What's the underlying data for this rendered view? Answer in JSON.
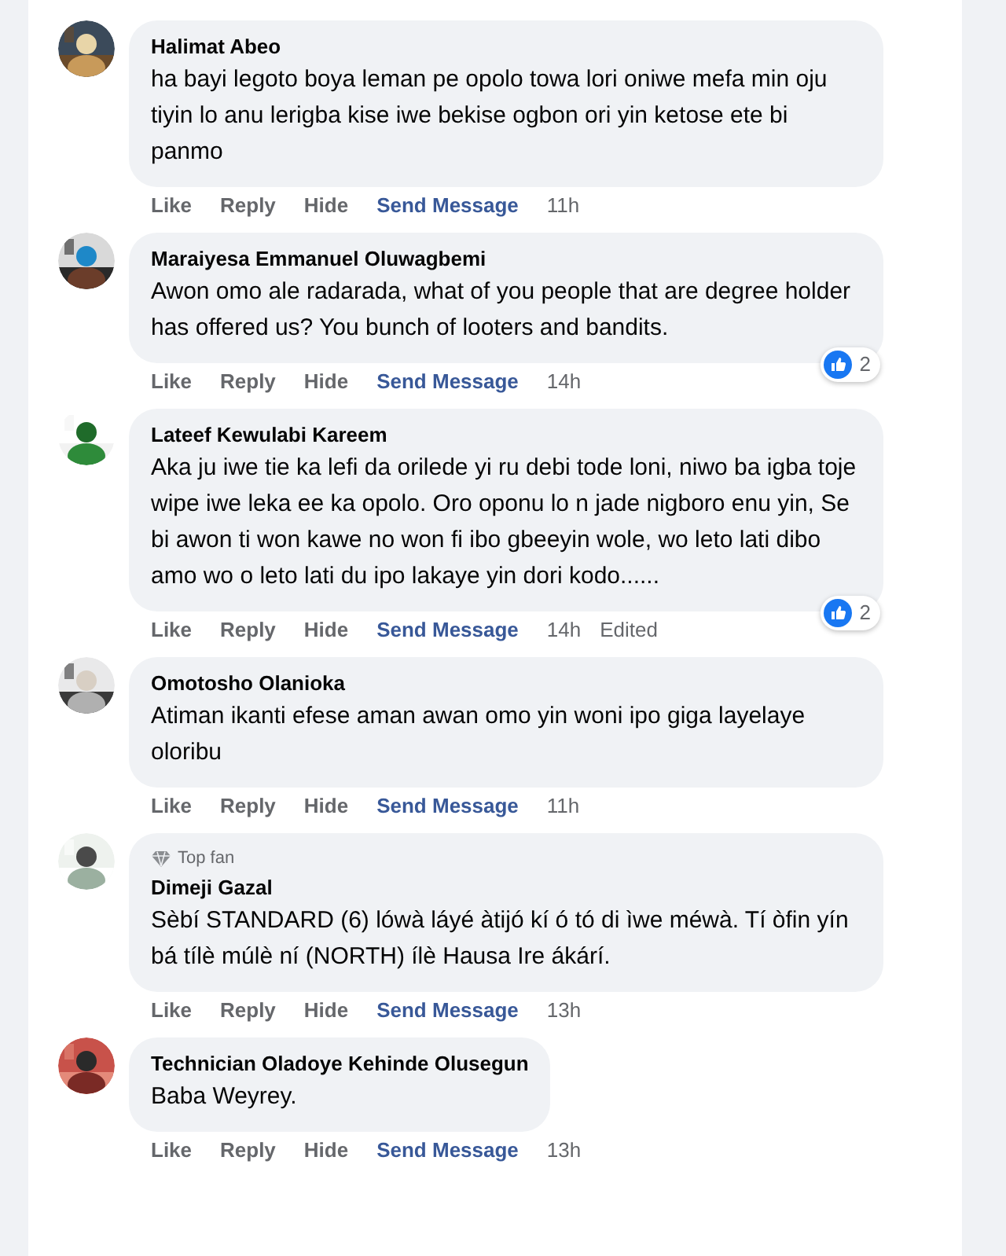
{
  "comments": [
    {
      "author": "Halimat Abeo",
      "text": "ha bayi legoto boya leman pe opolo towa lori oniwe mefa min oju tiyin lo anu lerigba kise iwe bekise ogbon ori yin ketose ete bi panmo",
      "actions": [
        "Like",
        "Reply",
        "Hide",
        "Send Message"
      ],
      "time": "11h"
    },
    {
      "author": "Maraiyesa Emmanuel Oluwagbemi",
      "text": "Awon omo ale radarada, what of you people that are degree holder has offered us? You bunch of looters and bandits.",
      "actions": [
        "Like",
        "Reply",
        "Hide",
        "Send Message"
      ],
      "time": "14h",
      "reactions": "2"
    },
    {
      "author": "Lateef Kewulabi Kareem",
      "text": "Aka ju iwe tie ka lefi da orilede yi ru debi tode loni, niwo ba igba toje wipe iwe leka ee ka opolo. Oro oponu lo n jade nigboro enu yin, Se bi awon ti won kawe no won fi ibo gbeeyin wole, wo leto lati dibo amo wo o leto lati du ipo lakaye yin dori kodo......",
      "actions": [
        "Like",
        "Reply",
        "Hide",
        "Send Message"
      ],
      "time": "14h",
      "edited": "Edited",
      "reactions": "2"
    },
    {
      "author": "Omotosho Olanioka",
      "text": "Atiman ikanti efese aman awan omo yin woni ipo giga layelaye oloribu",
      "actions": [
        "Like",
        "Reply",
        "Hide",
        "Send Message"
      ],
      "time": "11h"
    },
    {
      "badge": "Top fan",
      "author": "Dimeji Gazal",
      "text": "Sèbí STANDARD (6) lówà láyé àtijó kí ó tó di ìwe méwà. Tí òfin yín bá tílè múlè ní (NORTH) ílè Hausa Ire ákárí.",
      "actions": [
        "Like",
        "Reply",
        "Hide",
        "Send Message"
      ],
      "time": "13h"
    },
    {
      "author": "Technician Oladoye Kehinde Olusegun",
      "text": "Baba Weyrey.",
      "actions": [
        "Like",
        "Reply",
        "Hide",
        "Send Message"
      ],
      "time": "13h"
    }
  ]
}
